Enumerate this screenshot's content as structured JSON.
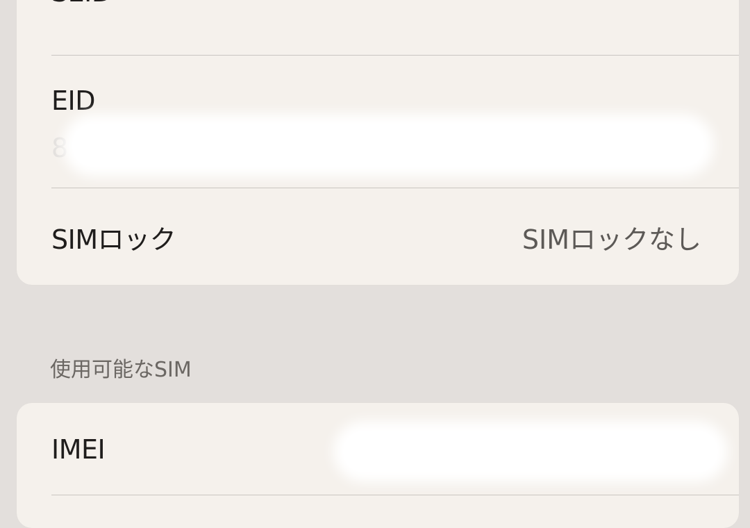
{
  "rows": {
    "seid": {
      "label": "SEID"
    },
    "eid": {
      "label": "EID",
      "value_visible": "8"
    },
    "sim_lock": {
      "label": "SIMロック",
      "value": "SIMロックなし"
    },
    "imei": {
      "label": "IMEI"
    }
  },
  "sections": {
    "available_sims": {
      "header": "使用可能なSIM"
    }
  },
  "icons": {
    "seid_disclosure": "chevron-right-icon"
  },
  "colors": {
    "background": "#e3dfdc",
    "card": "#f5f1ec",
    "label": "#1f1d1c",
    "secondary": "#5c5956"
  }
}
